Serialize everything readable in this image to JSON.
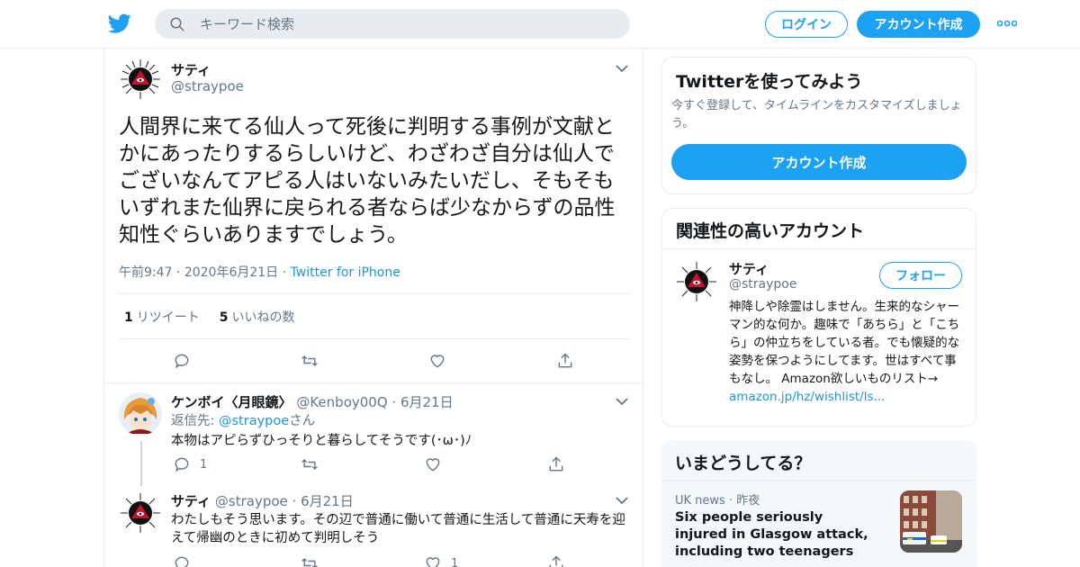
{
  "header": {
    "search_placeholder": "キーワード検索",
    "login_label": "ログイン",
    "signup_label": "アカウント作成"
  },
  "main_tweet": {
    "name": "サティ",
    "handle": "@straypoe",
    "text": "人間界に来てる仙人って死後に判明する事例が文献とかにあったりするらしいけど、わざわざ自分は仙人でございなんてアピる人はいないみたいだし、そもそもいずれまた仙界に戻られる者ならば少なからずの品性知性ぐらいありますでしょう。",
    "time": "午前9:47",
    "date": "2020年6月21日",
    "client": "Twitter for iPhone",
    "retweet_count": "1",
    "retweet_label": "リツイート",
    "like_count": "5",
    "like_label": "いいねの数"
  },
  "replies": [
    {
      "name": "ケンボイ〈月眼鏡〉",
      "handle": "@Kenboy00Q",
      "date": "6月21日",
      "reply_to_prefix": "返信先: ",
      "reply_to_handle": "@straypoe",
      "reply_to_suffix": "さん",
      "text": "本物はアピらずひっそりと暮らしてそうです(･ω･)ﾉ",
      "reply_count": "1"
    },
    {
      "name": "サティ",
      "handle": "@straypoe",
      "date": "6月21日",
      "text": "わたしもそう思います。その辺で普通に働いて普通に生活して普通に天寿を迎えて帰幽のときに初めて判明しそう",
      "like_count": "1"
    }
  ],
  "sidebar": {
    "signup_card": {
      "title": "Twitterを使ってみよう",
      "subtitle": "今すぐ登録して、タイムラインをカスタマイズしましょう。",
      "button": "アカウント作成"
    },
    "related": {
      "title": "関連性の高いアカウント",
      "name": "サティ",
      "handle": "@straypoe",
      "follow_label": "フォロー",
      "bio": "神降しや除霊はしません。生来的なシャーマン的な何か。趣味で「あちら」と「こちら」の仲立ちをしている者。でも懐疑的な姿勢を保つようにしてます。世はすべて事もなし。 Amazon欲しいものリスト→",
      "link": "amazon.jp/hz/wishlist/ls..."
    },
    "trends": {
      "title": "いまどうしてる？",
      "source": "UK news",
      "time": "昨夜",
      "headline": "Six people seriously injured in Glasgow attack, including two teenagers"
    }
  },
  "colors": {
    "accent": "#1da1f2",
    "link": "#1b95e0",
    "muted": "#657786",
    "border": "#e6ecf0"
  }
}
